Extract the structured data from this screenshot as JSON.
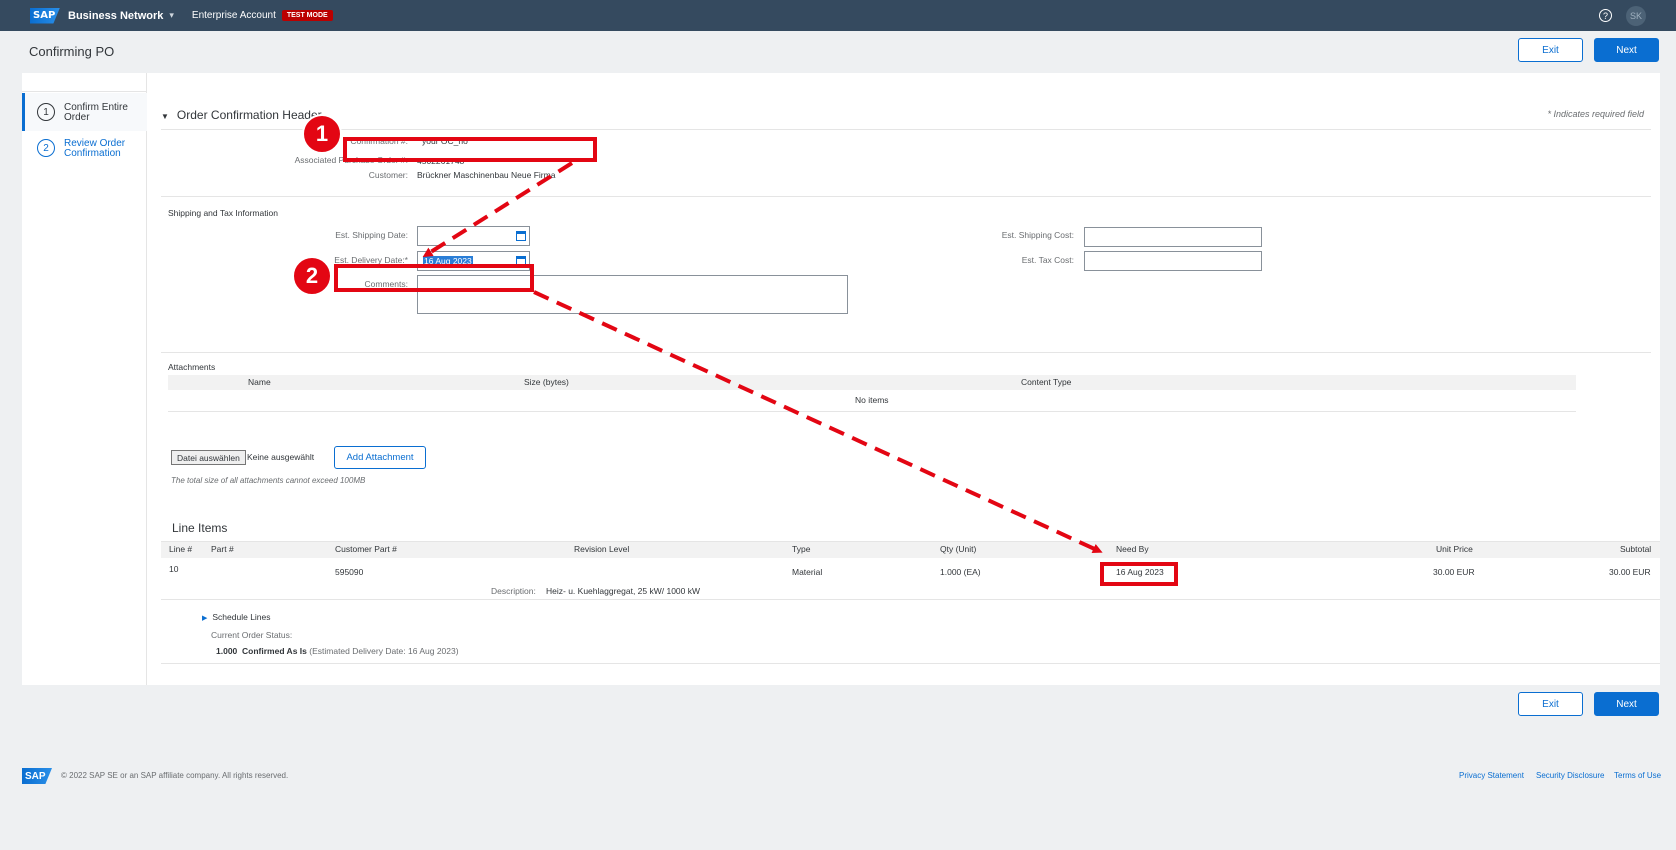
{
  "shell": {
    "logo": "SAP",
    "product": "Business Network",
    "account": "Enterprise Account",
    "badge": "TEST MODE",
    "help": "?",
    "user_initials": "SK"
  },
  "page": {
    "title": "Confirming PO",
    "exit_label": "Exit",
    "next_label": "Next"
  },
  "steps": [
    {
      "number": "1",
      "label": "Confirm Entire Order"
    },
    {
      "number": "2",
      "label": "Review Order Confirmation"
    }
  ],
  "header_section": {
    "title": "Order Confirmation Header",
    "required_note": "* Indicates required field",
    "confirmation_label": "Confirmation #:",
    "confirmation_value": "your OC_no",
    "po_label": "Associated Purchase Order #:",
    "po_value": "4502261748",
    "customer_label": "Customer:",
    "customer_value": "Brückner Maschinenbau Neue Firma"
  },
  "shipping": {
    "title": "Shipping and Tax Information",
    "ship_date_label": "Est. Shipping Date:",
    "ship_date_value": "",
    "delivery_label": "Est. Delivery Date:*",
    "delivery_value": "16 Aug 2023",
    "comments_label": "Comments:",
    "ship_cost_label": "Est. Shipping Cost:",
    "tax_cost_label": "Est. Tax Cost:"
  },
  "attachments": {
    "title": "Attachments",
    "columns": [
      "Name",
      "Size (bytes)",
      "Content Type"
    ],
    "empty": "No items",
    "choose_file": "Datei auswählen",
    "no_file": "Keine ausgewählt",
    "add_button": "Add Attachment",
    "hint": "The total size of all attachments cannot exceed 100MB"
  },
  "line_items": {
    "title": "Line Items",
    "columns": {
      "line": "Line #",
      "part": "Part #",
      "customer_part": "Customer Part #",
      "revision": "Revision Level",
      "type": "Type",
      "qty": "Qty (Unit)",
      "need_by": "Need By",
      "unit_price": "Unit Price",
      "subtotal": "Subtotal"
    },
    "row": {
      "line": "10",
      "customer_part": "595090",
      "type": "Material",
      "qty": "1.000 (EA)",
      "need_by": "16 Aug 2023",
      "unit_price": "30.00 EUR",
      "subtotal": "30.00 EUR",
      "description_label": "Description:",
      "description": "Heiz- u. Kuehlaggregat, 25 kW/ 1000 kW"
    },
    "schedule_lines": "Schedule Lines",
    "status_label": "Current Order Status:",
    "status_qty": "1.000",
    "status_value": "Confirmed As Is",
    "status_detail": "(Estimated Delivery Date: 16 Aug 2023)"
  },
  "annotations": {
    "badge1": "1",
    "badge2": "2",
    "color": "#e30613"
  },
  "footer": {
    "logo": "SAP",
    "copyright": "© 2022 SAP SE or an SAP affiliate company. All rights reserved.",
    "privacy": "Privacy Statement",
    "security": "Security Disclosure",
    "terms": "Terms of Use"
  }
}
